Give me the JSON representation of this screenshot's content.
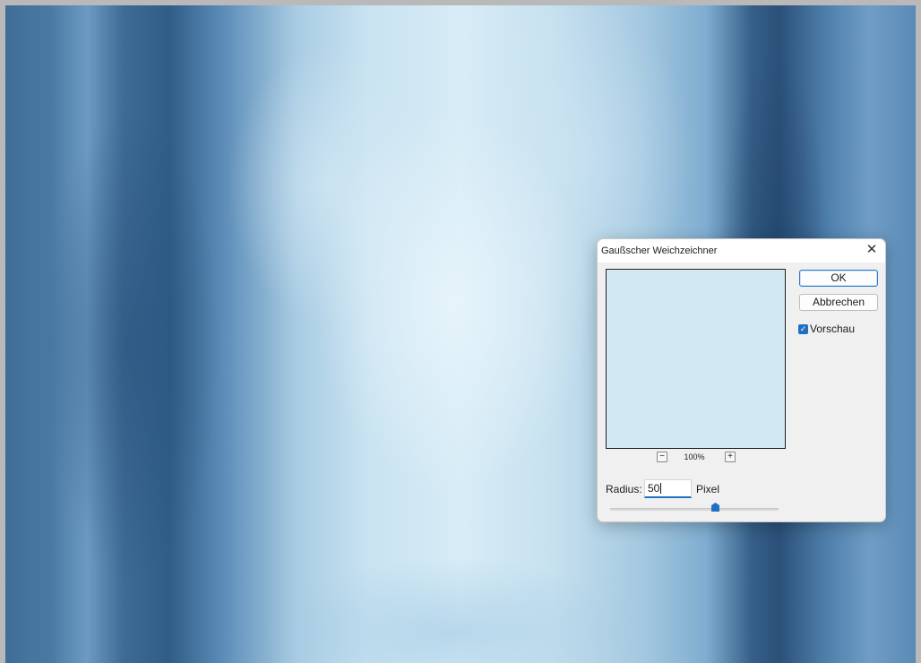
{
  "dialog": {
    "title": "Gaußscher Weichzeichner",
    "close_glyph": "✕",
    "ok_label": "OK",
    "cancel_label": "Abbrechen",
    "preview_checkbox": {
      "label": "Vorschau",
      "checked": true
    },
    "zoom": {
      "level": "100%",
      "out_glyph": "−",
      "in_glyph": "+"
    },
    "radius": {
      "label": "Radius:",
      "value": "50",
      "unit": "Pixel",
      "slider_fraction": 0.62
    },
    "colors": {
      "accent": "#1f6fc5",
      "preview_fill": "#d2e8f3"
    },
    "icons": [
      "close-icon",
      "zoom-out-icon",
      "zoom-in-icon",
      "checkmark-icon"
    ]
  }
}
